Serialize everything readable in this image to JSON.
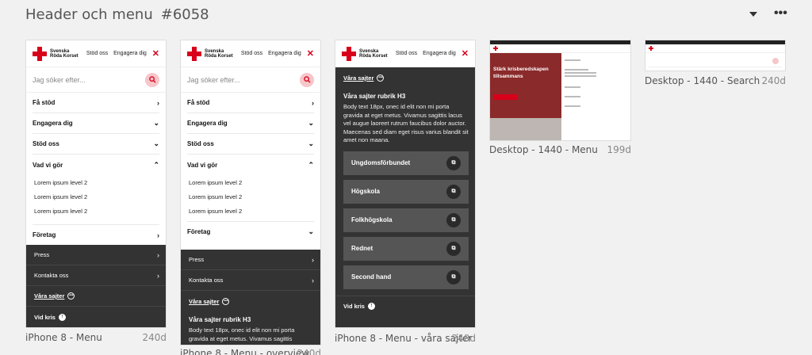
{
  "page": {
    "title": "Header och menu",
    "id": "#6058"
  },
  "colors": {
    "brand_red": "#d8001b",
    "dark_panel": "#333333",
    "button_grey": "#555555"
  },
  "header": {
    "logo_line1": "Svenska",
    "logo_line2": "Röda Korset",
    "link_stod": "Stöd oss",
    "link_engagera": "Engagera dig",
    "close_icon": "close-icon"
  },
  "search": {
    "placeholder": "Jag söker efter..."
  },
  "menu": {
    "fa_stod": "Få stöd",
    "engagera": "Engagera dig",
    "stod_oss": "Stöd oss",
    "vad_vi_gor": "Vad vi gör",
    "sub": [
      "Lorem ipsum level 2",
      "Lorem ipsum level 2",
      "Lorem ipsum level 2"
    ],
    "foretag": "Företag",
    "press": "Press",
    "kontakta": "Kontakta oss",
    "vara_sajter": "Våra sajter",
    "vid_kris": "Vid kris"
  },
  "sites": {
    "heading": "Våra sajter rubrik H3",
    "body": "Body text 18px, onec id elit non mi porta gravida at eget metus. Vivamus sagittis lacus vel augue laoreet rutrum faucibus dolor auctor. Maecenas sed diam eget risus varius blandit sit amet non maana.",
    "body_short": "Body text 18px, onec id elit non mi porta gravida at eget metus. Vivamus sagittis",
    "buttons": [
      "Ungdomsförbundet",
      "Högskola",
      "Folkhögskola",
      "Rednet",
      "Second hand"
    ]
  },
  "desktop_menu": {
    "hero": "Stärk krisberedskapen tillsammans"
  },
  "frames": [
    {
      "name": "iPhone 8 - Menu",
      "age": "240d"
    },
    {
      "name": "iPhone 8 - Menu - overview",
      "age": "240d"
    },
    {
      "name": "iPhone 8 - Menu - våra sajter",
      "age": "240d"
    },
    {
      "name": "Desktop - 1440 - Menu",
      "age": "199d"
    },
    {
      "name": "Desktop - 1440 - Search",
      "age": "240d"
    }
  ]
}
